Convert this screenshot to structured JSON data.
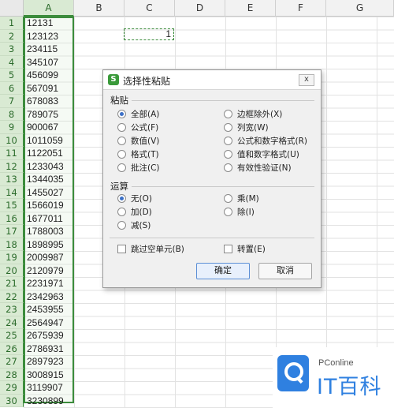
{
  "columns": [
    "A",
    "B",
    "C",
    "D",
    "E",
    "F",
    "G"
  ],
  "rows": [
    "1",
    "2",
    "3",
    "4",
    "5",
    "6",
    "7",
    "8",
    "9",
    "10",
    "11",
    "12",
    "13",
    "14",
    "15",
    "16",
    "17",
    "18",
    "19",
    "20",
    "21",
    "22",
    "23",
    "24",
    "25",
    "26",
    "27",
    "28",
    "29",
    "30"
  ],
  "colA_values": [
    "12131",
    "123123",
    "234115",
    "345107",
    "456099",
    "567091",
    "678083",
    "789075",
    "900067",
    "1011059",
    "1122051",
    "1233043",
    "1344035",
    "1455027",
    "1566019",
    "1677011",
    "1788003",
    "1898995",
    "2009987",
    "2120979",
    "2231971",
    "2342963",
    "2453955",
    "2564947",
    "2675939",
    "2786931",
    "2897923",
    "3008915",
    "3119907",
    "3230899"
  ],
  "c2_value": "1",
  "dialog": {
    "title": "选择性粘贴",
    "close": "x",
    "paste_label": "粘贴",
    "paste_left": [
      "全部(A)",
      "公式(F)",
      "数值(V)",
      "格式(T)",
      "批注(C)"
    ],
    "paste_right": [
      "边框除外(X)",
      "列宽(W)",
      "公式和数字格式(R)",
      "值和数字格式(U)",
      "有效性验证(N)"
    ],
    "op_label": "运算",
    "op_left": [
      "无(O)",
      "加(D)",
      "减(S)"
    ],
    "op_right": [
      "乘(M)",
      "除(I)"
    ],
    "skip_blanks": "跳过空单元(B)",
    "transpose": "转置(E)",
    "ok": "确定",
    "cancel": "取消"
  },
  "watermark": {
    "brand": "PConline",
    "name": "IT百科"
  },
  "colors": {
    "selection": "#3c8c3c",
    "accent": "#2f80e0"
  }
}
